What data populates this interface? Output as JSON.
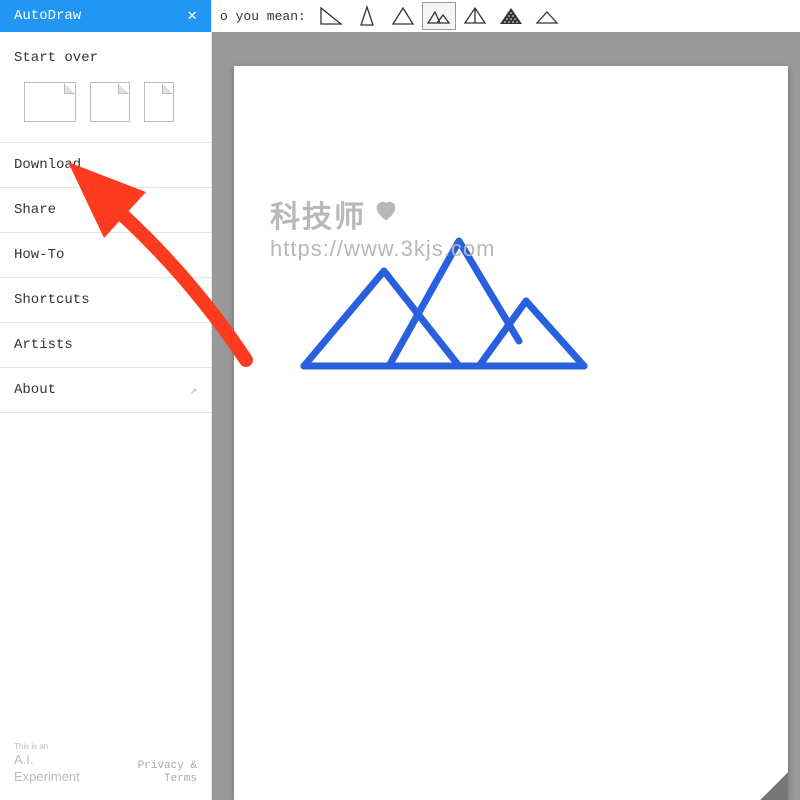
{
  "header": {
    "title": "AutoDraw",
    "close": "✕"
  },
  "topbar": {
    "hint": "o you mean:"
  },
  "sidebar": {
    "start_over": "Start over",
    "items": [
      {
        "label": "Download",
        "external": false
      },
      {
        "label": "Share",
        "external": false
      },
      {
        "label": "How-To",
        "external": false
      },
      {
        "label": "Shortcuts",
        "external": false
      },
      {
        "label": "Artists",
        "external": false
      },
      {
        "label": "About",
        "external": true
      }
    ],
    "footer": {
      "line1": "This is an",
      "line2": "A.I.",
      "line3": "Experiment",
      "privacy": "Privacy &",
      "terms": "Terms"
    }
  },
  "suggestions": {
    "icons": [
      "right-triangle-icon",
      "tall-triangle-icon",
      "equilateral-triangle-icon",
      "mountains-icon",
      "pyramid-3d-icon",
      "dotted-pyramid-icon",
      "flat-triangle-icon"
    ],
    "selected_index": 3
  },
  "watermark": {
    "line1": "科技师",
    "line2": "https://www.3kjs.com"
  }
}
